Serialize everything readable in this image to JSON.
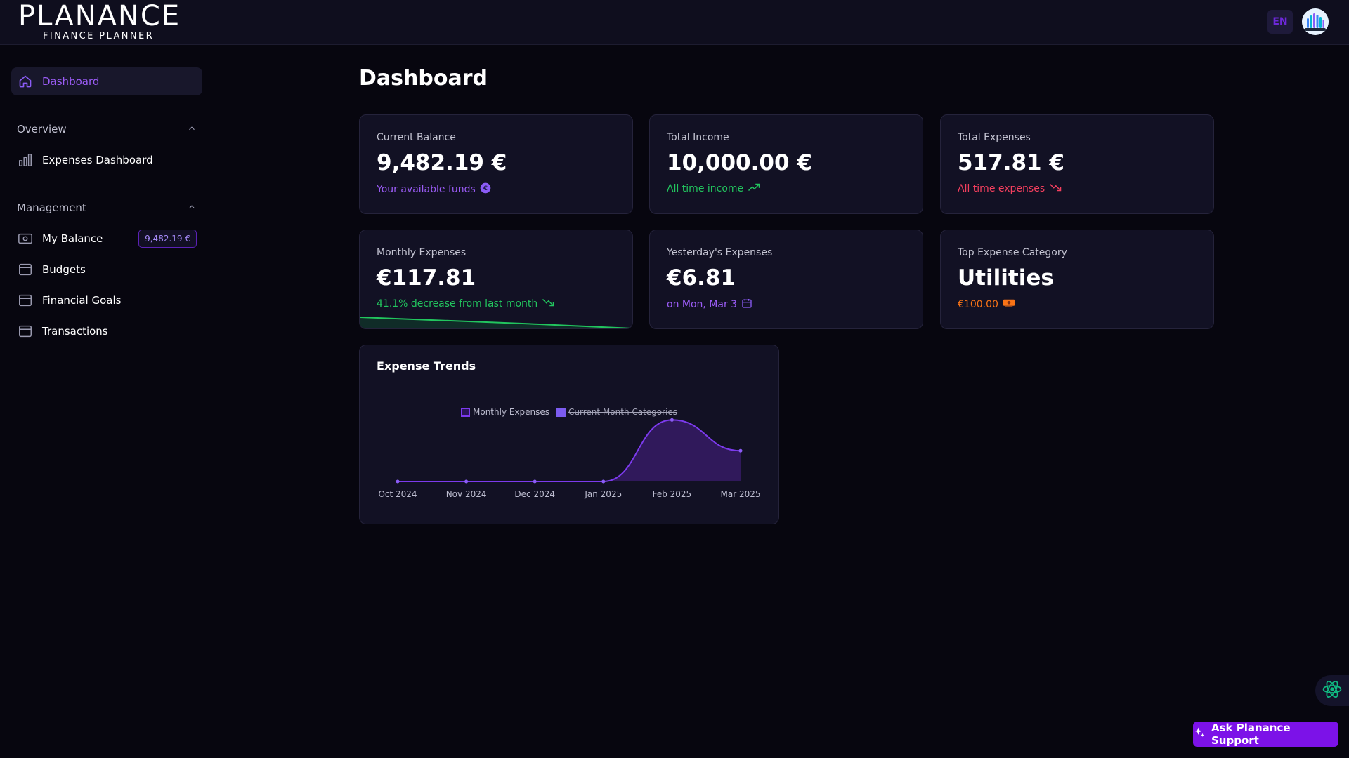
{
  "header": {
    "logo_main": "PLANANCE",
    "logo_sub": "FINANCE PLANNER",
    "language": "EN"
  },
  "sidebar": {
    "dashboard_label": "Dashboard",
    "overview": {
      "title": "Overview",
      "items": [
        {
          "label": "Expenses Dashboard",
          "icon": "bar-chart-icon"
        }
      ]
    },
    "management": {
      "title": "Management",
      "items": [
        {
          "label": "My Balance",
          "icon": "wallet-icon",
          "badge": "9,482.19 €"
        },
        {
          "label": "Budgets",
          "icon": "archive-icon"
        },
        {
          "label": "Financial Goals",
          "icon": "archive-icon"
        },
        {
          "label": "Transactions",
          "icon": "archive-icon"
        }
      ]
    }
  },
  "main": {
    "title": "Dashboard",
    "cards": [
      {
        "label": "Current Balance",
        "value": "9,482.19 €",
        "sub": "Your available funds",
        "sub_color": "#9b5cf6"
      },
      {
        "label": "Total Income",
        "value": "10,000.00 €",
        "sub": "All time income",
        "sub_color": "#22c55e"
      },
      {
        "label": "Total Expenses",
        "value": "517.81 €",
        "sub": "All time expenses",
        "sub_color": "#f43f5e"
      },
      {
        "label": "Monthly Expenses",
        "value": "€117.81",
        "sub": "41.1% decrease from last month",
        "sub_color": "#22c55e"
      },
      {
        "label": "Yesterday's Expenses",
        "value": "€6.81",
        "sub": "on Mon, Mar 3",
        "sub_color": "#9b5cf6"
      },
      {
        "label": "Top Expense Category",
        "value": "Utilities",
        "sub": "€100.00",
        "sub_color": "#f97316"
      }
    ],
    "trend": {
      "title": "Expense Trends"
    }
  },
  "chart_data": {
    "type": "area",
    "title": "Expense Trends",
    "categories": [
      "Oct 2024",
      "Nov 2024",
      "Dec 2024",
      "Jan 2025",
      "Feb 2025",
      "Mar 2025"
    ],
    "series": [
      {
        "name": "Monthly Expenses",
        "values": [
          0,
          0,
          0,
          0,
          400,
          200
        ],
        "color": "#7c3aed",
        "visible": true
      },
      {
        "name": "Current Month Categories",
        "values": [],
        "color": "#7c5cf0",
        "visible": false
      }
    ],
    "ylim": [
      0,
      420
    ],
    "legend": "top-center",
    "grid": false
  },
  "support": {
    "label": "Ask Planance Support"
  },
  "colors": {
    "accent": "#7c12e8",
    "positive": "#22c55e",
    "negative": "#f43f5e",
    "warning": "#f97316"
  }
}
